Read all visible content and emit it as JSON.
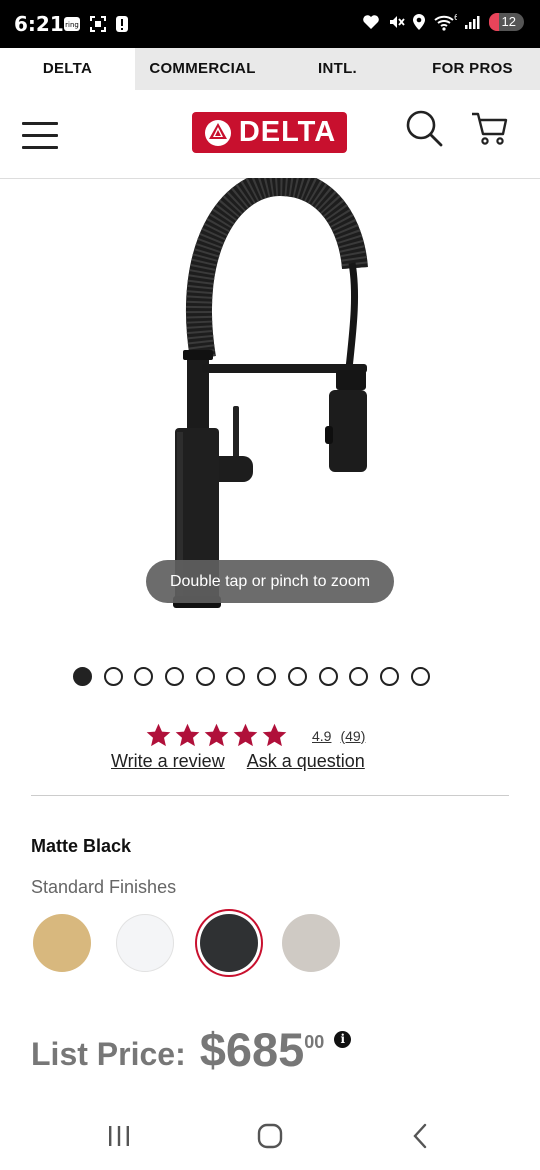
{
  "status_bar": {
    "time": "6:21",
    "battery": "12",
    "network_sup": "6"
  },
  "brand_tabs": [
    {
      "label": "DELTA",
      "active": true
    },
    {
      "label": "COMMERCIAL",
      "active": false
    },
    {
      "label": "INTL.",
      "active": false
    },
    {
      "label": "FOR PROS",
      "active": false
    }
  ],
  "header": {
    "logo_text": "DELTA"
  },
  "gallery": {
    "zoom_hint": "Double tap or pinch to zoom",
    "image_count": 12,
    "active_index": 0
  },
  "rating": {
    "stars": 5,
    "value": "4.9",
    "count": "(49)",
    "write_review": "Write a review",
    "ask_question": "Ask a question"
  },
  "finish": {
    "selected_name": "Matte Black",
    "group_label": "Standard Finishes",
    "swatches": [
      {
        "name": "champagne-bronze",
        "color": "#d8b87e",
        "selected": false
      },
      {
        "name": "white",
        "color": "#f4f5f7",
        "selected": false
      },
      {
        "name": "matte-black",
        "color": "#2f3133",
        "selected": true
      },
      {
        "name": "stainless",
        "color": "#cfcac4",
        "selected": false
      }
    ]
  },
  "price": {
    "label": "List Price:",
    "dollars": "$685",
    "cents": "00"
  },
  "colors": {
    "brand_red": "#c8102e",
    "star_red": "#b0103a"
  }
}
